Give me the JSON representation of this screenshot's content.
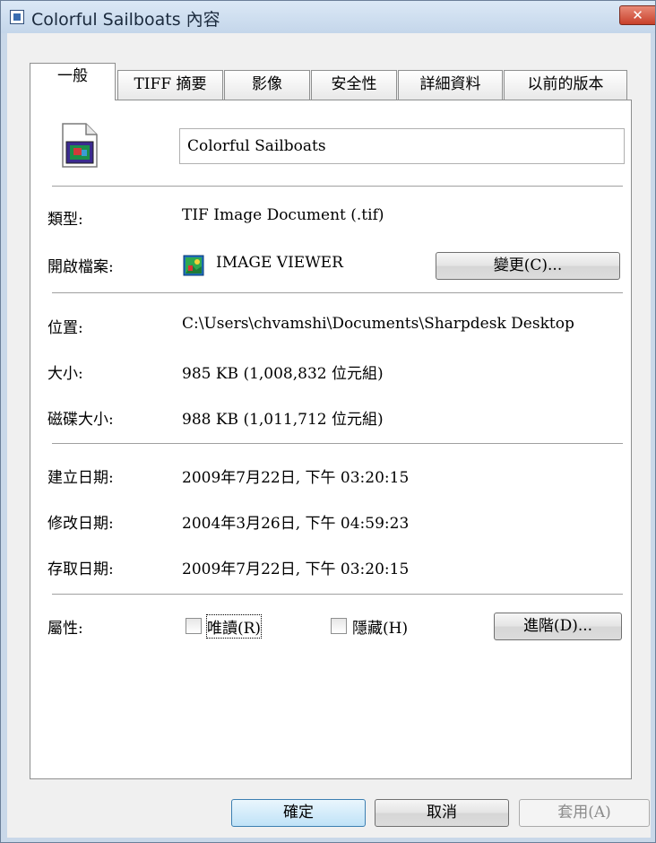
{
  "window": {
    "title": "Colorful Sailboats 內容",
    "close_label": "✕"
  },
  "tabs": [
    {
      "label": "一般",
      "active": true
    },
    {
      "label": "TIFF 摘要",
      "active": false
    },
    {
      "label": "影像",
      "active": false
    },
    {
      "label": "安全性",
      "active": false
    },
    {
      "label": "詳細資料",
      "active": false
    },
    {
      "label": "以前的版本",
      "active": false
    }
  ],
  "file": {
    "name": "Colorful Sailboats",
    "type_label": "類型:",
    "type_value": "TIF Image Document (.tif)",
    "opens_with_label": "開啟檔案:",
    "opens_with_value": "IMAGE VIEWER",
    "change_button": "變更(C)...",
    "location_label": "位置:",
    "location_value": "C:\\Users\\chvamshi\\Documents\\Sharpdesk Desktop",
    "size_label": "大小:",
    "size_value": "985 KB (1,008,832 位元組)",
    "size_on_disk_label": "磁碟大小:",
    "size_on_disk_value": "988 KB (1,011,712 位元組)",
    "created_label": "建立日期:",
    "created_value": "2009年7月22日, 下午 03:20:15",
    "modified_label": "修改日期:",
    "modified_value": "2004年3月26日, 下午 04:59:23",
    "accessed_label": "存取日期:",
    "accessed_value": "2009年7月22日, 下午 03:20:15",
    "attributes_label": "屬性:",
    "readonly_label": "唯讀(R)",
    "readonly_checked": false,
    "hidden_label": "隱藏(H)",
    "hidden_checked": false,
    "advanced_button": "進階(D)..."
  },
  "footer": {
    "ok": "確定",
    "cancel": "取消",
    "apply": "套用(A)"
  }
}
